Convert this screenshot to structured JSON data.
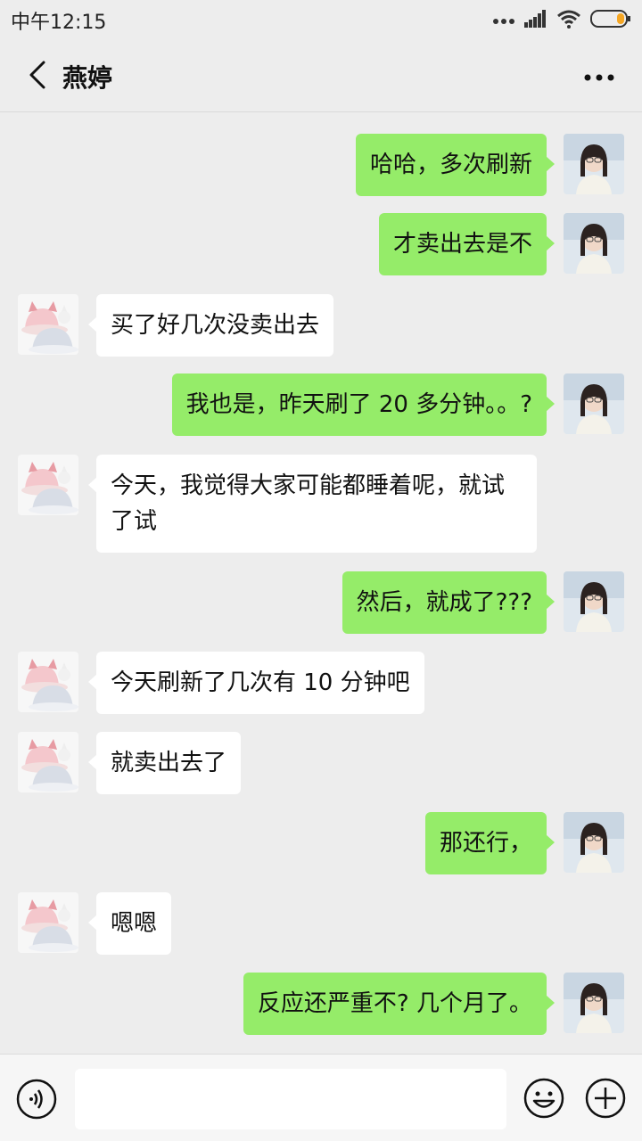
{
  "status_bar": {
    "time": "中午12:15",
    "icons": [
      "more-dots-icon",
      "signal-icon",
      "wifi-icon",
      "battery-icon"
    ]
  },
  "header": {
    "title": "燕婷",
    "back_icon": "chevron-left-icon",
    "more_icon": "more-horizontal-icon"
  },
  "messages": [
    {
      "side": "right",
      "text": "哈哈，多次刷新"
    },
    {
      "side": "right",
      "text": "才卖出去是不"
    },
    {
      "side": "left",
      "text": "买了好几次没卖出去"
    },
    {
      "side": "right",
      "text": "我也是，昨天刷了 20 多分钟。。?"
    },
    {
      "side": "left",
      "text": "今天，我觉得大家可能都睡着呢，就试了试"
    },
    {
      "side": "right",
      "text": "然后，就成了???"
    },
    {
      "side": "left",
      "text": "今天刷新了几次有 10 分钟吧"
    },
    {
      "side": "left",
      "text": "就卖出去了"
    },
    {
      "side": "right",
      "text": "那还行，"
    },
    {
      "side": "left",
      "text": "嗯嗯"
    },
    {
      "side": "right",
      "text": "反应还严重不? 几个月了。"
    }
  ],
  "input_bar": {
    "input_value": "",
    "voice_icon": "voice-icon",
    "emoji_icon": "emoji-icon",
    "plus_icon": "plus-icon"
  },
  "colors": {
    "background": "#ededed",
    "sent_bubble": "#95ec69",
    "received_bubble": "#ffffff"
  }
}
